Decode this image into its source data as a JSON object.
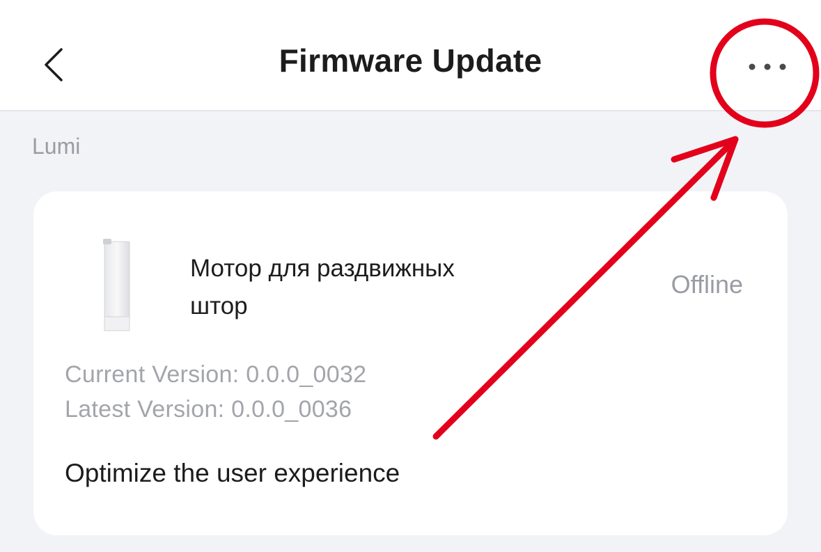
{
  "header": {
    "title": "Firmware Update",
    "back_icon": "chevron-left-icon",
    "more_icon": "more-dots-icon"
  },
  "section": {
    "label": "Lumi"
  },
  "device": {
    "name": "Мотор для раздвижных штор",
    "status": "Offline",
    "image": "curtain-motor-image",
    "current_version": "Current Version: 0.0.0_0032",
    "latest_version": "Latest Version: 0.0.0_0036",
    "description": "Optimize the user experience"
  },
  "annotation": {
    "color": "#e3001b",
    "shapes": [
      "highlight-circle",
      "pointer-arrow"
    ]
  },
  "colors": {
    "background": "#f2f3f7",
    "card": "#ffffff",
    "text_primary": "#1c1c1e",
    "text_secondary": "#9a9ca3"
  }
}
